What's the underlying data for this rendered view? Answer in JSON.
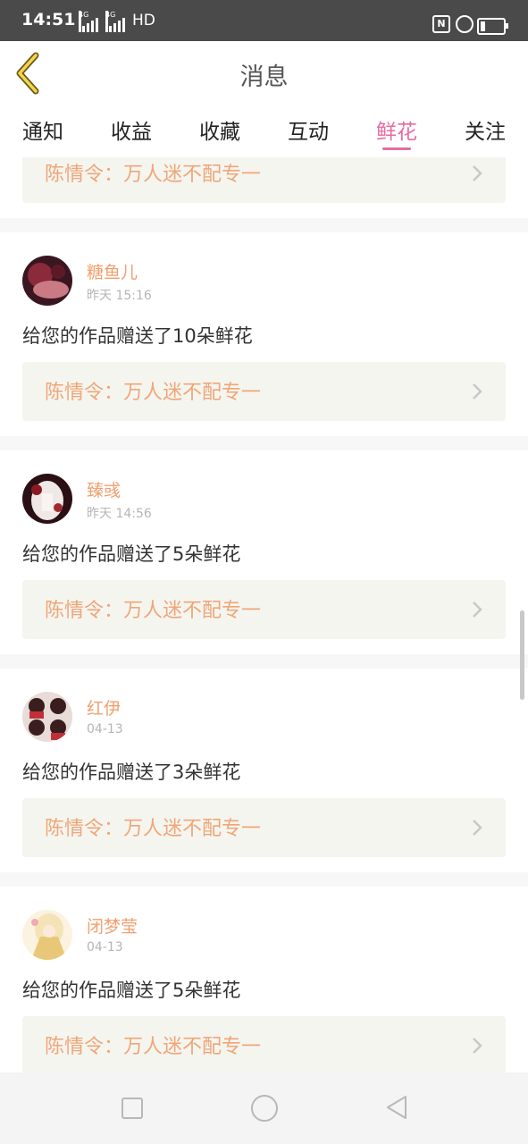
{
  "status_bar": {
    "time": "14:51",
    "network_1": "4G",
    "network_2": "4G",
    "hd": "HD",
    "nfc": "N"
  },
  "header": {
    "title": "消息",
    "back_icon": "chevron-left-icon"
  },
  "tabs": [
    {
      "label": "通知"
    },
    {
      "label": "收益"
    },
    {
      "label": "收藏"
    },
    {
      "label": "互动"
    },
    {
      "label": "鲜花",
      "active": true
    },
    {
      "label": "关注"
    }
  ],
  "top_partial": {
    "work_title": "陈情令：万人迷不配专一"
  },
  "cards": [
    {
      "username": "糖鱼儿",
      "time": "昨天 15:16",
      "message": "给您的作品赠送了10朵鲜花",
      "work_title": "陈情令：万人迷不配专一"
    },
    {
      "username": "臻彧",
      "time": "昨天 14:56",
      "message": "给您的作品赠送了5朵鲜花",
      "work_title": "陈情令：万人迷不配专一"
    },
    {
      "username": "红伊",
      "time": "04-13",
      "message": "给您的作品赠送了3朵鲜花",
      "work_title": "陈情令：万人迷不配专一"
    },
    {
      "username": "闭梦莹",
      "time": "04-13",
      "message": "给您的作品赠送了5朵鲜花",
      "work_title": "陈情令：万人迷不配专一"
    }
  ],
  "colors": {
    "accent": "#e86aa2",
    "username": "#f0a070",
    "work_title": "#f0a678",
    "link_bg": "#f5f5ef"
  }
}
